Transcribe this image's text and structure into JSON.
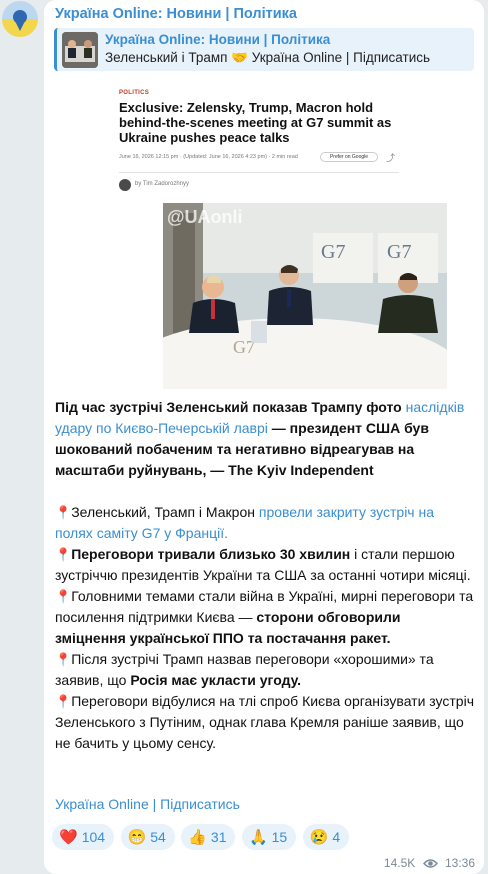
{
  "channel": {
    "name": "Україна Online: Новини | Політика"
  },
  "forward": {
    "title": "Україна Online: Новини | Політика",
    "text": "Зеленський і Трамп 🤝 Україна Online | Підписатись"
  },
  "article": {
    "section": "POLITICS",
    "headline": "Exclusive: Zelensky, Trump, Macron hold behind-the-scenes meeting at G7 summit as Ukraine pushes peace talks",
    "meta": "June 16, 2026 12:15 pm  ·  (Updated: June 16, 2026 4:23 pm)  ·  2 min read",
    "google_label": "Prefer on Google",
    "author": "by Tim Zadorozhnyy",
    "watermark": "@UAonli",
    "g7_sign": "G7",
    "table_text": "G7"
  },
  "message": {
    "p1_pre": "Під час зустрічі Зеленський показав Трампу фото ",
    "p1_link": "наслідків удару по Києво-Печерській лаврі",
    "p1_bold": " — президент США був шокований побаченим та негативно відреагував на масштаби руйнувань, — The Kyiv Independent",
    "p2_pin": "📍",
    "p2_pre": "Зеленський, Трамп і Макрон ",
    "p2_link": "провели закриту зустріч на полях саміту G7 у Франції.",
    "p3_pin": "📍",
    "p3_bold": "Переговори тривали близько 30 хвилин",
    "p3_post": " і стали першою зустріччю президентів України та США за останні чотири місяці.",
    "p4_pin": "📍",
    "p4_pre": "Головними темами стали війна в Україні, мирні переговори та посилення підтримки Києва — ",
    "p4_bold": "сторони обговорили зміцнення української ППО та постачання ракет.",
    "p5_pin": "📍",
    "p5_pre": "Після зустрічі Трамп назвав переговори «хорошими» та заявив, що ",
    "p5_bold": "Росія має укласти угоду.",
    "p6_pin": "📍",
    "p6_text": "Переговори відбулися на тлі спроб Києва організувати зустріч Зеленського з Путіним, однак глава Кремля раніше заявив, що не бачить у цьому сенсу."
  },
  "footer_link": "Україна Online | Підписатись",
  "reactions": [
    {
      "emoji": "❤️",
      "count": "104",
      "icon": "heart-icon"
    },
    {
      "emoji": "😁",
      "count": "54",
      "icon": "grin-icon"
    },
    {
      "emoji": "👍",
      "count": "31",
      "icon": "thumbs-up-icon"
    },
    {
      "emoji": "🙏",
      "count": "15",
      "icon": "pray-icon"
    },
    {
      "emoji": "😢",
      "count": "4",
      "icon": "cry-icon"
    }
  ],
  "meta": {
    "views": "14.5K",
    "time": "13:36"
  },
  "colors": {
    "accent": "#3a8ed1",
    "bubble": "#ffffff",
    "background": "#e6ebee",
    "reaction_bg": "#e8f2fb"
  }
}
